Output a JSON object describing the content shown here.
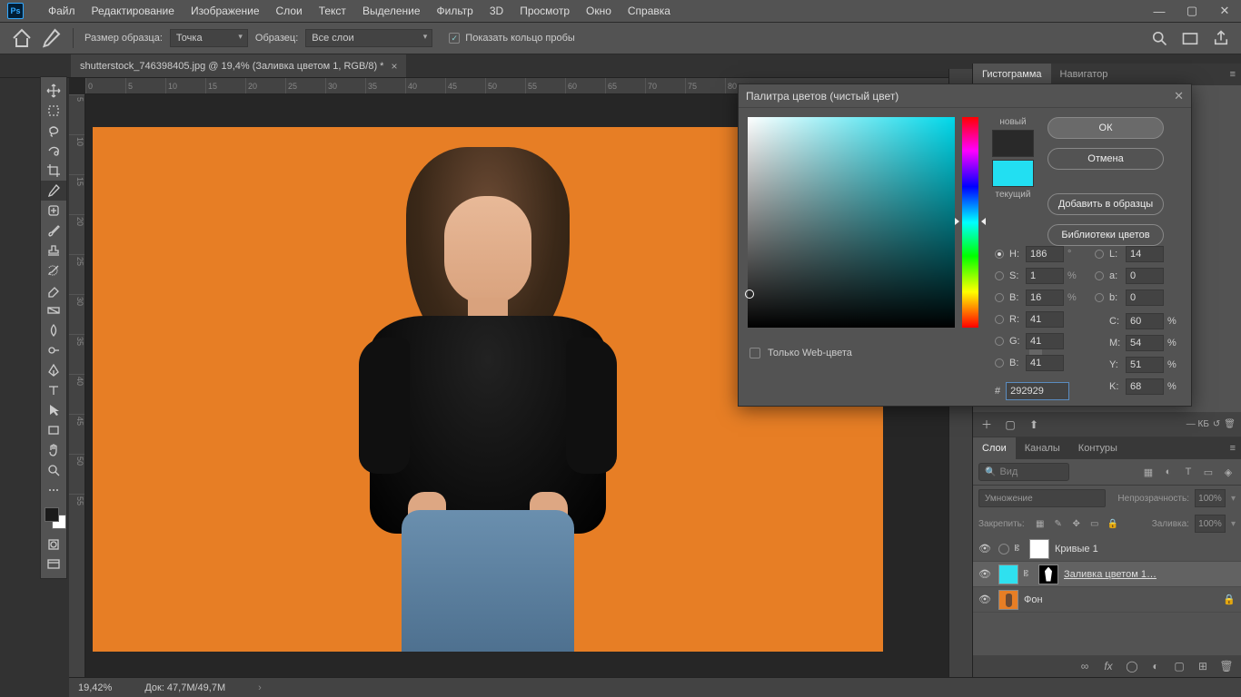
{
  "app_logo": "Ps",
  "menu": [
    "Файл",
    "Редактирование",
    "Изображение",
    "Слои",
    "Текст",
    "Выделение",
    "Фильтр",
    "3D",
    "Просмотр",
    "Окно",
    "Справка"
  ],
  "options_bar": {
    "sample_size_label": "Размер образца:",
    "sample_size_value": "Точка",
    "sample_label": "Образец:",
    "sample_value": "Все слои",
    "show_ring_label": "Показать кольцо пробы"
  },
  "document": {
    "tab_title": "shutterstock_746398405.jpg @ 19,4% (Заливка цветом 1, RGB/8) *"
  },
  "status": {
    "zoom": "19,42%",
    "doc_info": "Док: 47,7М/49,7М"
  },
  "panel_tabs_top": {
    "histogram": "Гистограмма",
    "navigator": "Навигатор"
  },
  "layers_panel": {
    "tabs": {
      "layers": "Слои",
      "channels": "Каналы",
      "paths": "Контуры"
    },
    "search_placeholder": "Вид",
    "blend_mode": "Умножение",
    "opacity_label": "Непрозрачность:",
    "opacity_value": "100%",
    "lock_label": "Закрепить:",
    "fill_label": "Заливка:",
    "fill_value": "100%",
    "kb_label": "— КБ",
    "layers": [
      {
        "name": "Кривые 1",
        "thumb": "#ffffff",
        "has_fx": true,
        "selected": false
      },
      {
        "name": "Заливка цветом 1…",
        "thumb": "#2fe0ef",
        "has_mask": true,
        "selected": true
      },
      {
        "name": "Фон",
        "thumb": "#e77e25",
        "locked": true,
        "selected": false
      }
    ]
  },
  "color_picker": {
    "title": "Палитра цветов (чистый цвет)",
    "new_label": "новый",
    "current_label": "текущий",
    "ok": "ОК",
    "cancel": "Отмена",
    "add_swatches": "Добавить в образцы",
    "color_libraries": "Библиотеки цветов",
    "web_only_label": "Только Web-цвета",
    "values": {
      "H": "186",
      "S": "1",
      "Bv": "16",
      "R": "41",
      "G": "41",
      "B": "41",
      "L": "14",
      "a": "0",
      "b": "0",
      "C": "60",
      "M": "54",
      "Y": "51",
      "K": "68",
      "hex": "292929"
    },
    "labels": {
      "H": "H:",
      "S": "S:",
      "Bv": "B:",
      "R": "R:",
      "G": "G:",
      "B": "B:",
      "L": "L:",
      "a": "a:",
      "b": "b:",
      "C": "C:",
      "M": "M:",
      "Y": "Y:",
      "K": "K:",
      "hash": "#",
      "deg": "°",
      "pct": "%"
    }
  },
  "ruler_h": [
    "0",
    "5",
    "10",
    "15",
    "20",
    "25",
    "30",
    "35",
    "40",
    "45",
    "50",
    "55",
    "60",
    "65",
    "70",
    "75",
    "80"
  ],
  "ruler_v": [
    "5",
    "10",
    "15",
    "20",
    "25",
    "30",
    "35",
    "40",
    "45",
    "50",
    "55"
  ]
}
